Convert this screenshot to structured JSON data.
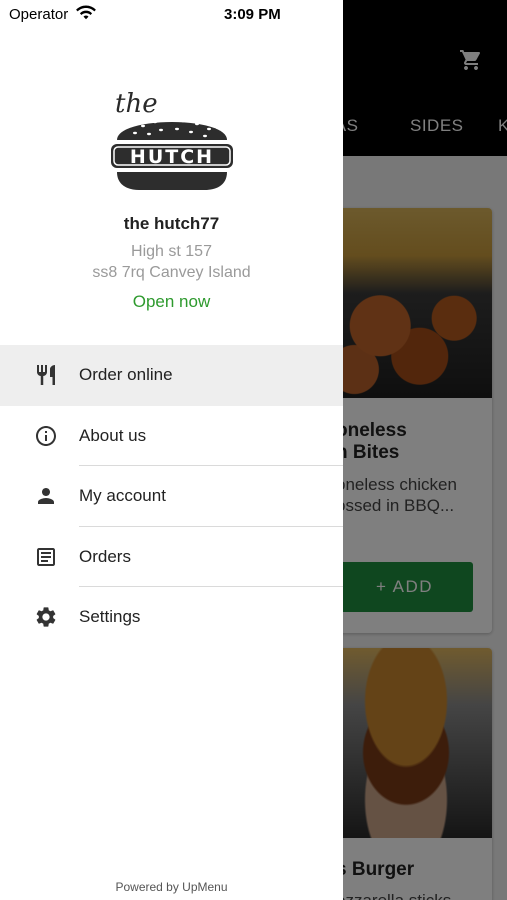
{
  "status_bar": {
    "carrier": "Operator",
    "time": "3:09 PM"
  },
  "background": {
    "tabs": [
      "RAS",
      "SIDES",
      "K"
    ],
    "cards": [
      {
        "title_lines": [
          "oneless",
          "n Bites"
        ],
        "desc_lines": [
          "oneless chicken",
          "ossed in BBQ..."
        ],
        "button": "+ ADD"
      },
      {
        "title_lines": [
          "s Burger"
        ],
        "desc_lines": [
          "ozzarella sticks"
        ]
      }
    ]
  },
  "drawer": {
    "logo_text": {
      "script": "the",
      "word": "HUTCH"
    },
    "store_name": "the hutch77",
    "address_line1": "High st 157",
    "address_line2": "ss8 7rq Canvey Island",
    "open_status": "Open now",
    "menu": [
      {
        "label": "Order online",
        "icon": "cutlery-icon",
        "active": true
      },
      {
        "label": "About us",
        "icon": "info-icon",
        "active": false
      },
      {
        "label": "My account",
        "icon": "person-icon",
        "active": false
      },
      {
        "label": "Orders",
        "icon": "receipt-icon",
        "active": false
      },
      {
        "label": "Settings",
        "icon": "gear-icon",
        "active": false
      }
    ],
    "powered_by": "Powered by UpMenu"
  },
  "colors": {
    "accent_green": "#2e9a2e",
    "add_button": "#1f8f3e",
    "topbar": "#000000"
  }
}
